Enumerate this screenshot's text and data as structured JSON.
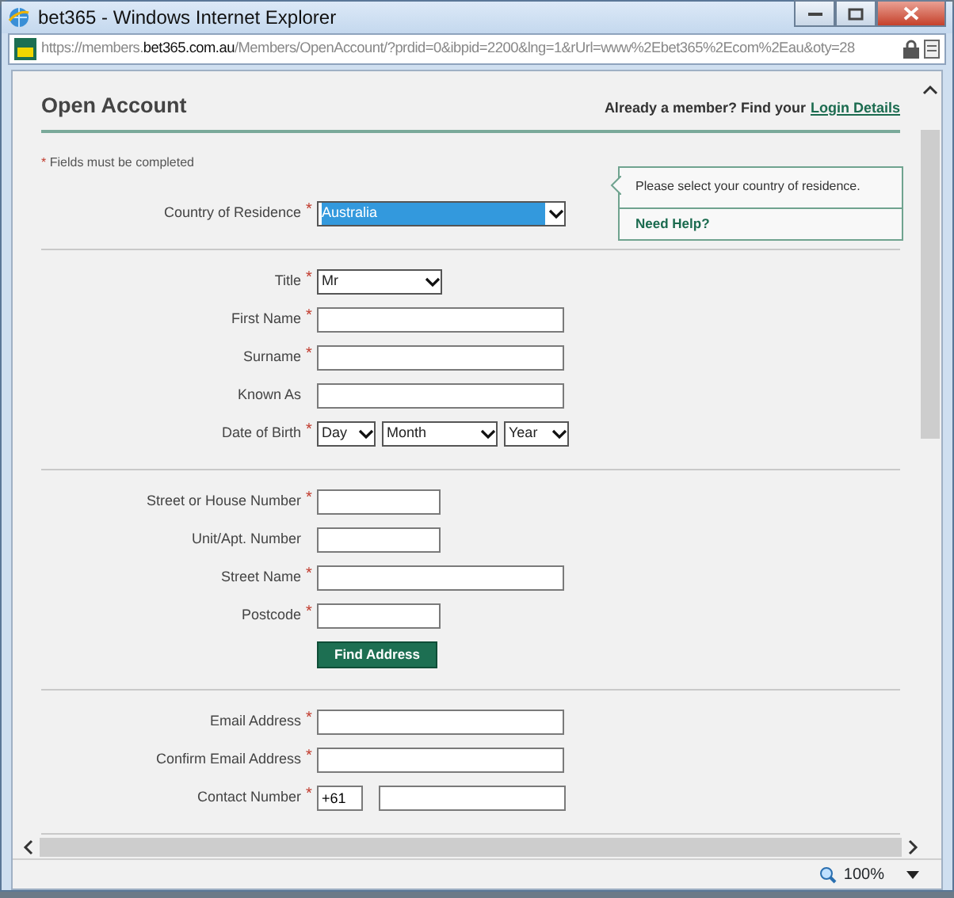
{
  "window": {
    "title": "bet365 - Windows Internet Explorer"
  },
  "address_bar": {
    "url": "https://members.**bet365.com.au**/Members/OpenAccount/?prdid=0&ibpid=2200&lng=1&rUrl=www%2Ebet365%2Ecom%2Eau&oty=28"
  },
  "page": {
    "heading": "Open Account",
    "member_prompt": "Already a member? Find your",
    "login_link": "Login Details",
    "required_mark": "*",
    "required_note": "Fields must be completed"
  },
  "tooltip": {
    "text": "Please select your country of residence.",
    "link": "Need Help?"
  },
  "sections": [
    {
      "fields": [
        {
          "kind": "select",
          "label": "Country of Residence",
          "marker": "*",
          "value": "Australia",
          "highlighted": true
        }
      ]
    },
    {
      "fields": [
        {
          "kind": "short-select",
          "label": "Title",
          "marker": "*",
          "value": "Mr",
          "highlighted": false
        },
        {
          "kind": "text",
          "label": "First Name",
          "marker": "*"
        },
        {
          "kind": "text",
          "label": "Surname",
          "marker": "*"
        },
        {
          "kind": "text",
          "label": "Known As"
        },
        {
          "kind": "date",
          "label": "Date of Birth",
          "marker": "*",
          "parts": [
            "Day",
            "Month",
            "Year"
          ]
        }
      ]
    },
    {
      "fields": [
        {
          "kind": "short-text",
          "label": "Street or House Number",
          "marker": "*"
        },
        {
          "kind": "short-text",
          "label": "Unit/Apt. Number"
        },
        {
          "kind": "text",
          "label": "Street Name",
          "marker": "*"
        },
        {
          "kind": "short-text",
          "label": "Postcode",
          "marker": "*"
        },
        {
          "kind": "button",
          "label": "Find Address"
        }
      ]
    },
    {
      "fields": [
        {
          "kind": "text",
          "label": "Email Address",
          "marker": "*"
        },
        {
          "kind": "text",
          "label": "Confirm Email Address",
          "marker": "*"
        },
        {
          "kind": "phone",
          "label": "Contact Number",
          "marker": "*",
          "prefix": "+61"
        }
      ]
    }
  ],
  "status_bar": {
    "zoom": "100%"
  }
}
